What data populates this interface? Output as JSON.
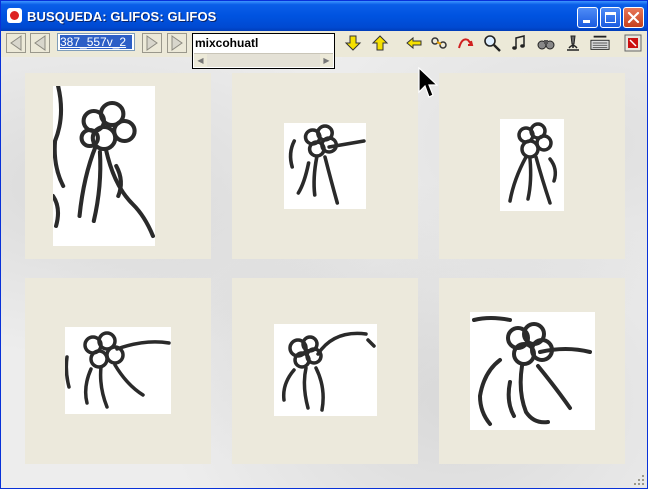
{
  "window": {
    "title": "BUSQUEDA: GLIFOS: GLIFOS",
    "app_icon": "app-icon",
    "controls": [
      "minimize-icon",
      "maximize-icon",
      "close-icon"
    ]
  },
  "toolbar": {
    "record_field": {
      "value": "387_557v_2"
    },
    "search": {
      "value": "mixcohuatl"
    },
    "tools": [
      "arrow-down-icon",
      "arrow-up-icon",
      "back-arrow-icon",
      "link-icon",
      "return-arrow-icon",
      "magnifier-icon",
      "music-notes-icon",
      "binoculars-icon",
      "microscope-icon",
      "keyboard-icon",
      "exit-icon"
    ]
  },
  "glyphs": [
    {
      "name": "glyph-1"
    },
    {
      "name": "glyph-2"
    },
    {
      "name": "glyph-3"
    },
    {
      "name": "glyph-4"
    },
    {
      "name": "glyph-5"
    },
    {
      "name": "glyph-6"
    }
  ]
}
